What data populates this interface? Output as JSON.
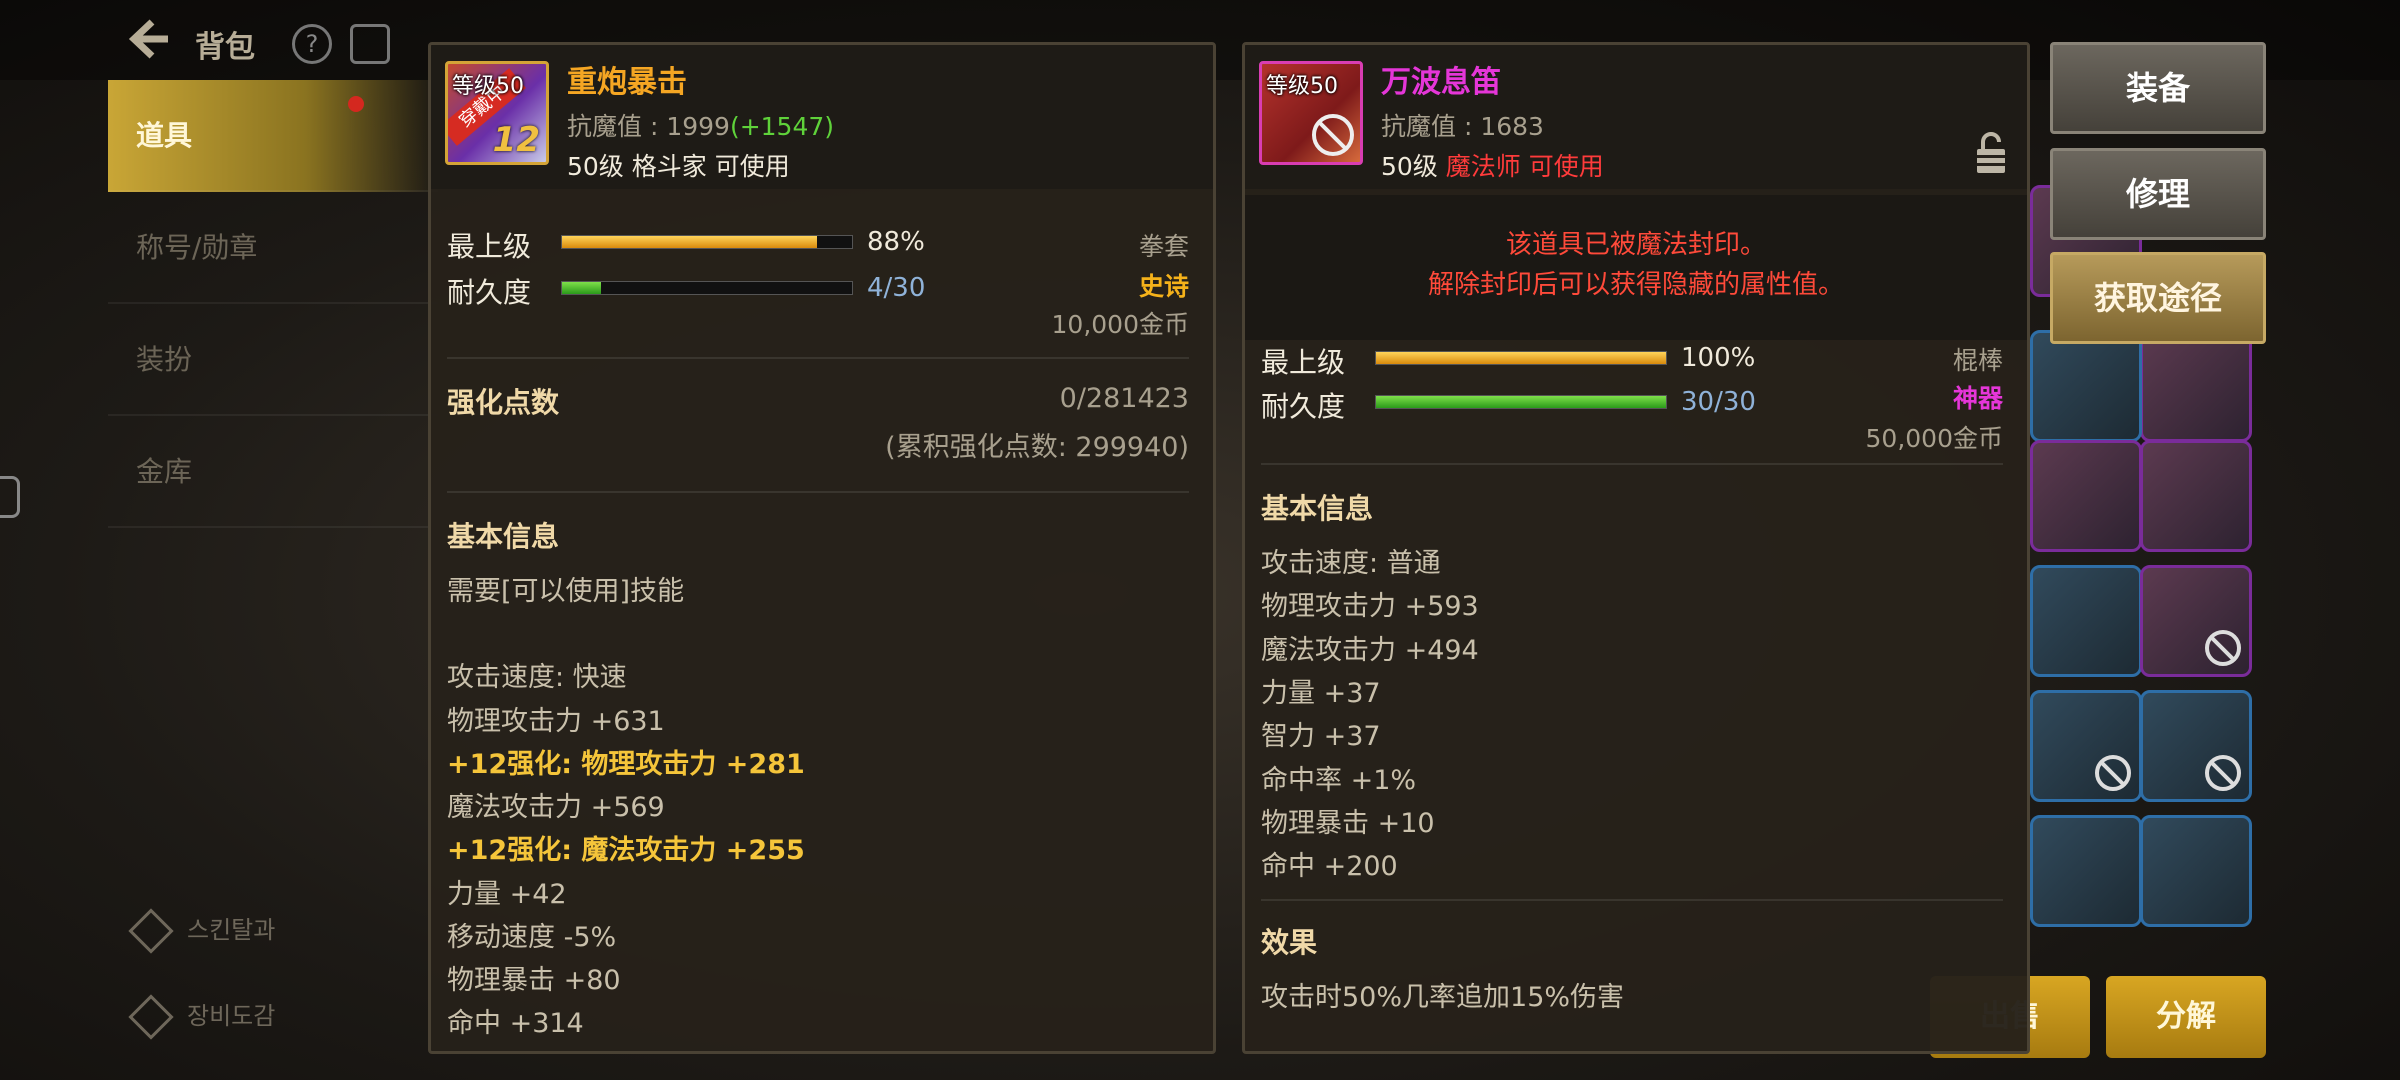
{
  "background": {
    "title": "背包",
    "sidebar": [
      {
        "label": "道具",
        "active": true
      },
      {
        "label": "称号/勋章",
        "active": false
      },
      {
        "label": "装扮",
        "active": false
      },
      {
        "label": "金库",
        "active": false
      }
    ],
    "footer": [
      "스킨탈과",
      "장비도감"
    ],
    "bottom_buttons": [
      "出售",
      "分解"
    ]
  },
  "left_item": {
    "level_tag": "等级50",
    "equipped_ribbon": "穿戴中",
    "reinforce_badge": "12",
    "name": "重炮暴击",
    "name_color": "#f5a623",
    "anti_magic": "抗魔值 : 1999",
    "anti_magic_gain": "(+1547)",
    "requirement": "50级 格斗家 可使用",
    "max_level_label": "最上级",
    "max_level_value": "88%",
    "max_level_fill": 0.88,
    "durability_label": "耐久度",
    "durability_value": "4/30",
    "durability_fill": 0.133,
    "type": "拳套",
    "rarity": "史诗",
    "rarity_color": "#f5b21a",
    "price": "10,000金币",
    "reinforce_points_label": "强化点数",
    "reinforce_points": "0/281423",
    "accumulated": "(累积强化点数: 299940)",
    "basic_info_title": "基本信息",
    "skill_req": "需要[可以使用]技能",
    "stats": [
      {
        "text": "攻击速度:  快速",
        "highlight": false
      },
      {
        "text": "物理攻击力 +631",
        "highlight": false
      },
      {
        "text": "+12强化:  物理攻击力 +281",
        "highlight": true
      },
      {
        "text": "魔法攻击力 +569",
        "highlight": false
      },
      {
        "text": "+12强化:  魔法攻击力 +255",
        "highlight": true
      },
      {
        "text": "力量 +42",
        "highlight": false
      },
      {
        "text": "移动速度 -5%",
        "highlight": false
      },
      {
        "text": "物理暴击 +80",
        "highlight": false
      },
      {
        "text": "命中 +314",
        "highlight": false
      }
    ]
  },
  "right_item": {
    "level_tag": "等级50",
    "name": "万波息笛",
    "name_color": "#e536d8",
    "anti_magic": "抗魔值 : 1683",
    "req_level": "50级",
    "req_class": "魔法师 可使用",
    "seal_line1": "该道具已被魔法封印。",
    "seal_line2": "解除封印后可以获得隐藏的属性值。",
    "max_level_label": "最上级",
    "max_level_value": "100%",
    "max_level_fill": 1.0,
    "durability_label": "耐久度",
    "durability_value": "30/30",
    "durability_fill": 1.0,
    "type": "棍棒",
    "rarity": "神器",
    "rarity_color": "#e536d8",
    "price": "50,000金币",
    "basic_info_title": "基本信息",
    "stats": [
      "攻击速度:  普通",
      "物理攻击力 +593",
      "魔法攻击力 +494",
      "力量 +37",
      "智力 +37",
      "命中率 +1%",
      "物理暴击 +10",
      "命中 +200"
    ],
    "effect_title": "效果",
    "effect": "攻击时50%几率追加15%伤害"
  },
  "actions": [
    "装备",
    "修理",
    "获取途径"
  ]
}
